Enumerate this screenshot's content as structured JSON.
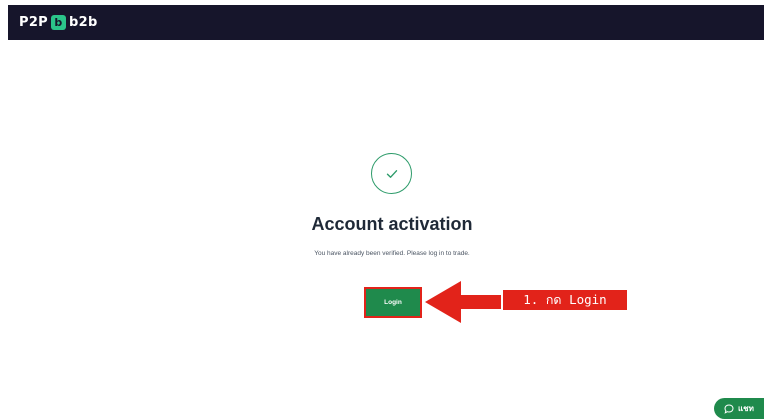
{
  "header": {
    "logo_prefix": "P2P",
    "logo_mark": "b",
    "logo_suffix": "b2b"
  },
  "main": {
    "status_icon": "check-icon",
    "title": "Account activation",
    "message": "You have already been verified. Please log in to trade.",
    "login_label": "Login"
  },
  "annotation": {
    "step_label": "1. กด Login",
    "color": "#e2231a"
  },
  "chat": {
    "icon": "chat-bubble-icon",
    "label": "แชท"
  },
  "colors": {
    "header_bg": "#16152b",
    "accent": "#1f8a4c",
    "logo_green": "#2bc48a"
  }
}
